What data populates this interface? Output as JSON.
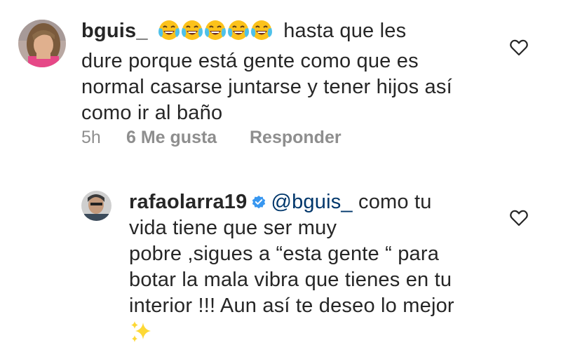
{
  "comments": [
    {
      "username": "bguis_",
      "emoji_icon": "face-with-tears-of-joy",
      "emoji_count": 5,
      "text_lines": [
        "hasta que les",
        "dure porque está gente como que es",
        "normal casarse juntarse y tener hijos así",
        "como ir al baño"
      ],
      "time": "5h",
      "likes": "6 Me gusta",
      "reply_label": "Responder",
      "like_icon": "heart-outline"
    },
    {
      "username": "rafaolarra19",
      "verified": true,
      "verified_icon": "verified-badge",
      "mention": "@bguis_",
      "text_lines": [
        "como tu",
        "vida tiene que ser muy",
        "pobre ,sigues a “esta gente “ para",
        "botar la mala vibra que tienes en tu",
        "interior !!! Aun así te deseo lo mejor"
      ],
      "trailing_emoji": "sparkles",
      "like_icon": "heart-outline"
    }
  ],
  "colors": {
    "text": "#262626",
    "secondary": "#8e8e8e",
    "mention": "#00376b",
    "verified": "#3897f0",
    "emoji_face": "#fcc21b",
    "emoji_tears": "#4fc1e9",
    "sparkles": "#fdd835"
  }
}
